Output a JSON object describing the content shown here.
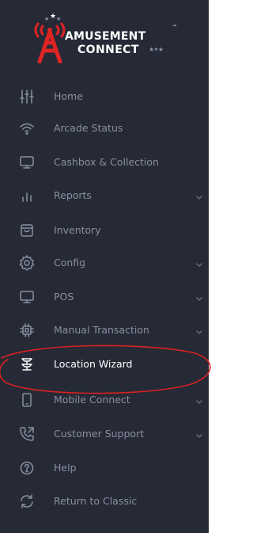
{
  "brand": {
    "line1": "AMUSEMENT",
    "line2": "CONNECT",
    "trademark": "™",
    "stars": "★✶★"
  },
  "nav": {
    "items": [
      {
        "label": "Home",
        "icon": "sliders-icon",
        "has_submenu": false
      },
      {
        "label": "Arcade Status",
        "icon": "wifi-icon",
        "has_submenu": false
      },
      {
        "label": "Cashbox & Collection",
        "icon": "monitor-icon",
        "has_submenu": false
      },
      {
        "label": "Reports",
        "icon": "bar-chart-icon",
        "has_submenu": true
      },
      {
        "label": "Inventory",
        "icon": "inbox-icon",
        "has_submenu": false
      },
      {
        "label": "Config",
        "icon": "gear-icon",
        "has_submenu": true
      },
      {
        "label": "POS",
        "icon": "monitor-icon",
        "has_submenu": true
      },
      {
        "label": "Manual Transaction",
        "icon": "chip-icon",
        "has_submenu": true
      },
      {
        "label": "Location Wizard",
        "icon": "location-wizard-icon",
        "has_submenu": false,
        "active": true
      },
      {
        "label": "Mobile Connect",
        "icon": "mobile-icon",
        "has_submenu": true
      },
      {
        "label": "Customer Support",
        "icon": "phone-icon",
        "has_submenu": true
      },
      {
        "label": "Help",
        "icon": "help-icon",
        "has_submenu": false
      },
      {
        "label": "Return to Classic",
        "icon": "refresh-icon",
        "has_submenu": false
      }
    ]
  },
  "colors": {
    "sidebar_bg": "#262a36",
    "text_muted": "#8a8f9f",
    "text_active": "#ffffff",
    "accent_red": "#e02424",
    "annotation_red": "#d92121"
  }
}
